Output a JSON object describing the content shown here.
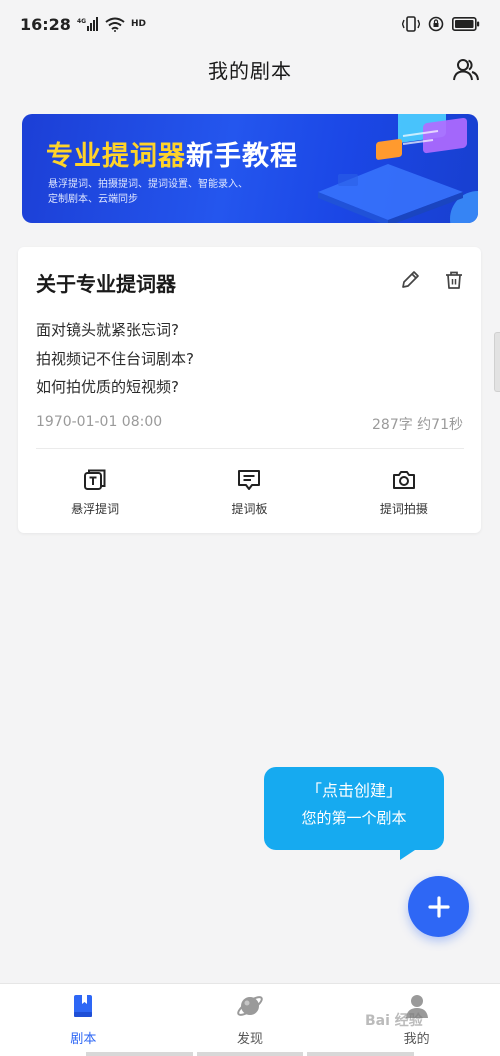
{
  "status_bar": {
    "time": "16:28",
    "network": "4G",
    "hd": "HD"
  },
  "header": {
    "title": "我的剧本"
  },
  "banner": {
    "title_highlight": "专业提词器",
    "title_rest": "新手教程",
    "subtitle_line1": "悬浮提词、拍摄提词、提词设置、智能录入、",
    "subtitle_line2": "定制剧本、云端同步"
  },
  "script_card": {
    "title": "关于专业提词器",
    "lines": [
      "面对镜头就紧张忘词?",
      "拍视频记不住台词剧本?",
      "如何拍优质的短视频?"
    ],
    "date": "1970-01-01 08:00",
    "count": "287字 约71秒",
    "actions": [
      {
        "label": "悬浮提词",
        "icon": "floating-prompter-icon"
      },
      {
        "label": "提词板",
        "icon": "prompter-board-icon"
      },
      {
        "label": "提词拍摄",
        "icon": "camera-icon"
      }
    ]
  },
  "tooltip": {
    "line1": "「点击创建」",
    "line2": "您的第一个剧本"
  },
  "tabs": [
    {
      "label": "剧本",
      "icon": "script-icon",
      "active": true
    },
    {
      "label": "发现",
      "icon": "planet-icon",
      "active": false
    },
    {
      "label": "我的",
      "icon": "user-icon",
      "active": false
    }
  ],
  "watermark": "Bai 经验",
  "colors": {
    "accent": "#2e67f5",
    "tooltip": "#16aaf0",
    "banner": "#1c3fd6"
  }
}
